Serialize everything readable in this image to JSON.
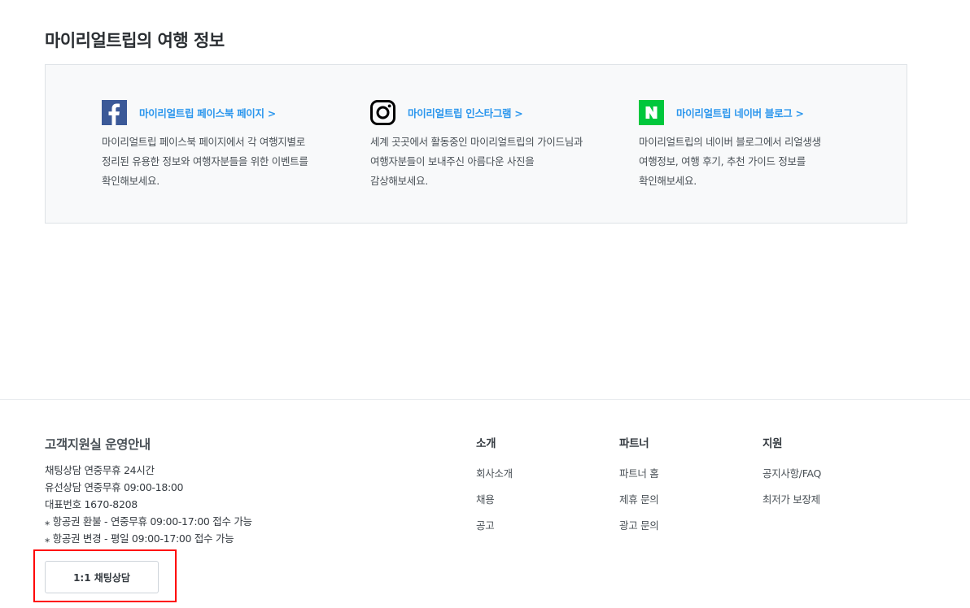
{
  "section": {
    "title": "마이리얼트립의 여행 정보"
  },
  "channels": [
    {
      "icon": "facebook-icon",
      "link": "마이리얼트립 페이스북 페이지 >",
      "description": "마이리얼트립 페이스북 페이지에서 각 여행지별로 정리된 유용한 정보와 여행자분들을 위한 이벤트를 확인해보세요.",
      "color": "#3b5998"
    },
    {
      "icon": "instagram-icon",
      "link": "마이리얼트립 인스타그램 >",
      "description": "세계 곳곳에서 활동중인 마이리얼트립의 가이드님과 여행자분들이 보내주신 아름다운 사진을 감상해보세요.",
      "color": "#000000"
    },
    {
      "icon": "naver-icon",
      "link": "마이리얼트립 네이버 블로그 >",
      "description": "마이리얼트립의 네이버 블로그에서 리얼생생 여행정보, 여행 후기, 추천 가이드 정보를 확인해보세요.",
      "color": "#00c73c"
    }
  ],
  "support": {
    "title": "고객지원실 운영안내",
    "lines": [
      "채팅상담 연중무휴 24시간",
      "유선상담 연중무휴 09:00-18:00",
      "대표번호 1670-8208",
      "⁎ 항공권 환불 - 연중무휴 09:00-17:00 접수 가능",
      "⁎ 항공권 변경 - 평일 09:00-17:00 접수 가능"
    ],
    "chat_button": "1:1 채팅상담"
  },
  "footer_columns": [
    {
      "title": "소개",
      "links": [
        "회사소개",
        "채용",
        "공고"
      ]
    },
    {
      "title": "파트너",
      "links": [
        "파트너 홈",
        "제휴 문의",
        "광고 문의"
      ]
    },
    {
      "title": "지원",
      "links": [
        "공지사항/FAQ",
        "최저가 보장제"
      ]
    }
  ],
  "colors": {
    "link": "#2b96ed",
    "highlight": "#ff0000",
    "box_bg": "#f8f9fa"
  }
}
